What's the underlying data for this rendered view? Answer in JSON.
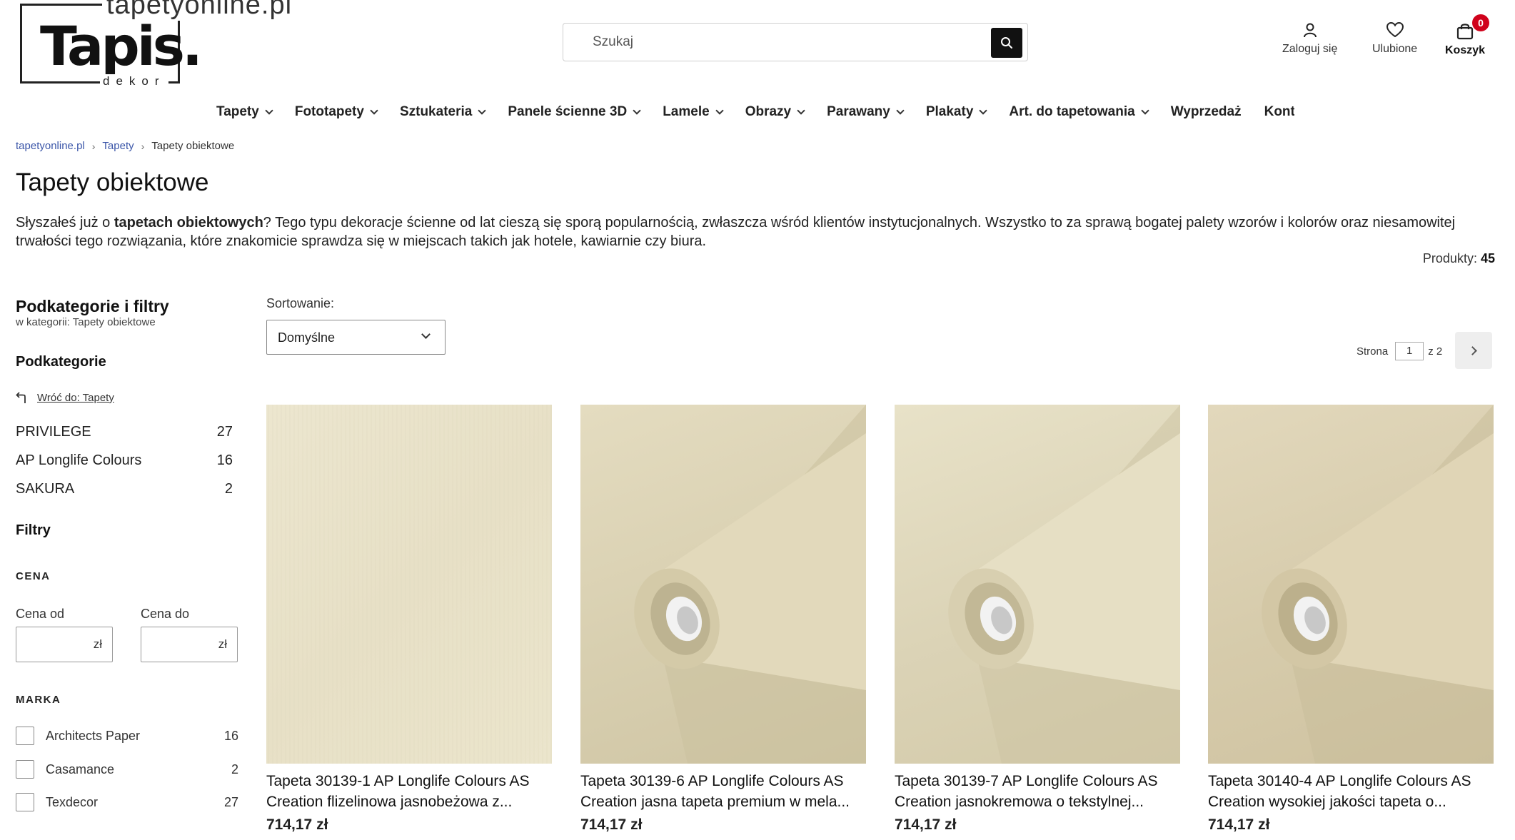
{
  "header": {
    "logo_domain": "tapetyonline.pl",
    "logo_brand": "Tapis.",
    "logo_sub": "dekor",
    "search_placeholder": "Szukaj",
    "login_label": "Zaloguj się",
    "favorites_label": "Ulubione",
    "cart_label": "Koszyk",
    "cart_count": "0"
  },
  "nav": [
    {
      "label": "Tapety",
      "dropdown": true
    },
    {
      "label": "Fototapety",
      "dropdown": true
    },
    {
      "label": "Sztukateria",
      "dropdown": true
    },
    {
      "label": "Panele ścienne 3D",
      "dropdown": true
    },
    {
      "label": "Lamele",
      "dropdown": true
    },
    {
      "label": "Obrazy",
      "dropdown": true
    },
    {
      "label": "Parawany",
      "dropdown": true
    },
    {
      "label": "Plakaty",
      "dropdown": true
    },
    {
      "label": "Art. do tapetowania",
      "dropdown": true
    },
    {
      "label": "Wyprzedaż",
      "dropdown": false
    },
    {
      "label": "Kont",
      "dropdown": false
    }
  ],
  "breadcrumb": {
    "home": "tapetyonline.pl",
    "parent": "Tapety",
    "current": "Tapety obiektowe"
  },
  "page": {
    "title": "Tapety obiektowe",
    "desc_pre": "Słyszałeś już o ",
    "desc_bold": "tapetach obiektowych",
    "desc_post": "? Tego typu dekoracje ścienne od lat cieszą się sporą popularnością, zwłaszcza wśród klientów instytucjonalnych. Wszystko to za sprawą bogatej palety wzorów i kolorów oraz niesamowitej trwałości tego rozwiązania, które znakomicie sprawdza się w miejscach takich jak hotele, kawiarnie czy biura.",
    "products_label": "Produkty:",
    "products_count": "45"
  },
  "sidebar": {
    "title": "Podkategorie i filtry",
    "subtitle": "w kategorii: Tapety obiektowe",
    "subcat_heading": "Podkategorie",
    "back_label": "Wróć do: Tapety",
    "subcategories": [
      {
        "name": "PRIVILEGE",
        "count": "27"
      },
      {
        "name": "AP Longlife Colours",
        "count": "16"
      },
      {
        "name": "SAKURA",
        "count": "2"
      }
    ],
    "filters_heading": "Filtry",
    "price_heading": "CENA",
    "price_from_label": "Cena od",
    "price_to_label": "Cena do",
    "currency": "zł",
    "brand_heading": "MARKA",
    "brands": [
      {
        "name": "Architects Paper",
        "count": "16"
      },
      {
        "name": "Casamance",
        "count": "2"
      },
      {
        "name": "Texdecor",
        "count": "27"
      }
    ]
  },
  "sorting": {
    "label": "Sortowanie:",
    "selected": "Domyślne"
  },
  "pager": {
    "label": "Strona",
    "current": "1",
    "of_label": "z 2"
  },
  "products": [
    {
      "name": "Tapeta 30139-1 AP Longlife Colours AS Creation flizelinowa jasnobeżowa z...",
      "price": "714,17 zł"
    },
    {
      "name": "Tapeta 30139-6 AP Longlife Colours AS Creation jasna tapeta premium w mela...",
      "price": "714,17 zł"
    },
    {
      "name": "Tapeta 30139-7 AP Longlife Colours AS Creation jasnokremowa o tekstylnej...",
      "price": "714,17 zł"
    },
    {
      "name": "Tapeta 30140-4 AP Longlife Colours AS Creation wysokiej jakości tapeta o...",
      "price": "714,17 zł"
    }
  ]
}
